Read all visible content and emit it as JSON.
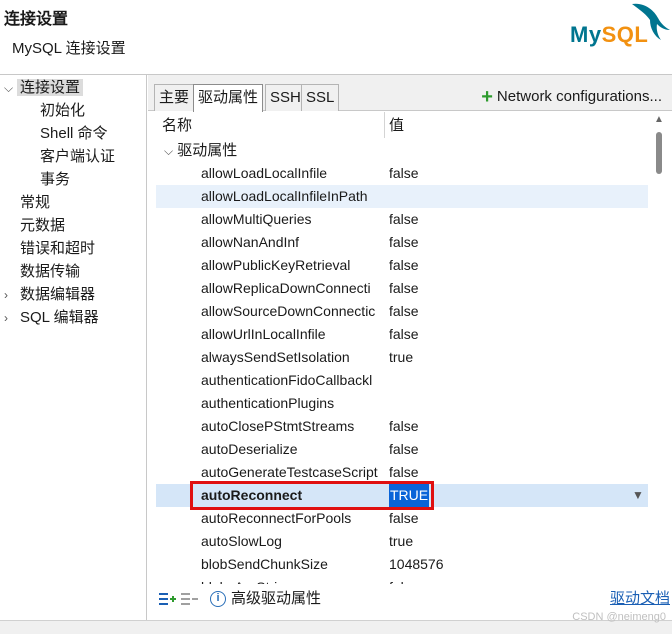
{
  "header": {
    "title": "连接设置",
    "subtitle": "MySQL 连接设置",
    "logo_text_my": "My",
    "logo_text_sql": "SQL"
  },
  "nav": {
    "items": [
      {
        "label": "连接设置",
        "expanded": true,
        "selected": true
      },
      {
        "label": "初始化"
      },
      {
        "label": "Shell 命令"
      },
      {
        "label": "客户端认证"
      },
      {
        "label": "事务"
      },
      {
        "label": "常规"
      },
      {
        "label": "元数据"
      },
      {
        "label": "错误和超时"
      },
      {
        "label": "数据传输"
      },
      {
        "label": "数据编辑器",
        "collapsed": true
      },
      {
        "label": "SQL 编辑器",
        "collapsed": true
      }
    ]
  },
  "tabs": [
    "主要",
    "驱动属性",
    "SSH",
    "SSL"
  ],
  "active_tab": "驱动属性",
  "network_configurations_label": "Network configurations...",
  "table": {
    "columns": [
      "名称",
      "值"
    ],
    "group_label": "驱动属性",
    "rows": [
      {
        "name": "allowLoadLocalInfile",
        "value": "false"
      },
      {
        "name": "allowLoadLocalInfileInPath",
        "value": ""
      },
      {
        "name": "allowMultiQueries",
        "value": "false"
      },
      {
        "name": "allowNanAndInf",
        "value": "false"
      },
      {
        "name": "allowPublicKeyRetrieval",
        "value": "false"
      },
      {
        "name": "allowReplicaDownConnecti",
        "value": "false"
      },
      {
        "name": "allowSourceDownConnectic",
        "value": "false"
      },
      {
        "name": "allowUrlInLocalInfile",
        "value": "false"
      },
      {
        "name": "alwaysSendSetIsolation",
        "value": "true"
      },
      {
        "name": "authenticationFidoCallbackl",
        "value": ""
      },
      {
        "name": "authenticationPlugins",
        "value": ""
      },
      {
        "name": "autoClosePStmtStreams",
        "value": "false"
      },
      {
        "name": "autoDeserialize",
        "value": "false"
      },
      {
        "name": "autoGenerateTestcaseScript",
        "value": "false"
      },
      {
        "name": "autoReconnect",
        "value": "TRUE"
      },
      {
        "name": "autoReconnectForPools",
        "value": "false"
      },
      {
        "name": "autoSlowLog",
        "value": "true"
      },
      {
        "name": "blobSendChunkSize",
        "value": "1048576"
      },
      {
        "name": "blobsAreStrings",
        "value": "false"
      }
    ]
  },
  "bottom": {
    "advanced_label": "高级驱动属性",
    "doc_link": "驱动文档"
  },
  "watermark": "CSDN @neimeng0",
  "colors": {
    "selection_value_bg": "#0a64d8",
    "highlight_box": "#e01010",
    "add_green": "#2e9b2e",
    "link_blue": "#1a5fb4"
  }
}
